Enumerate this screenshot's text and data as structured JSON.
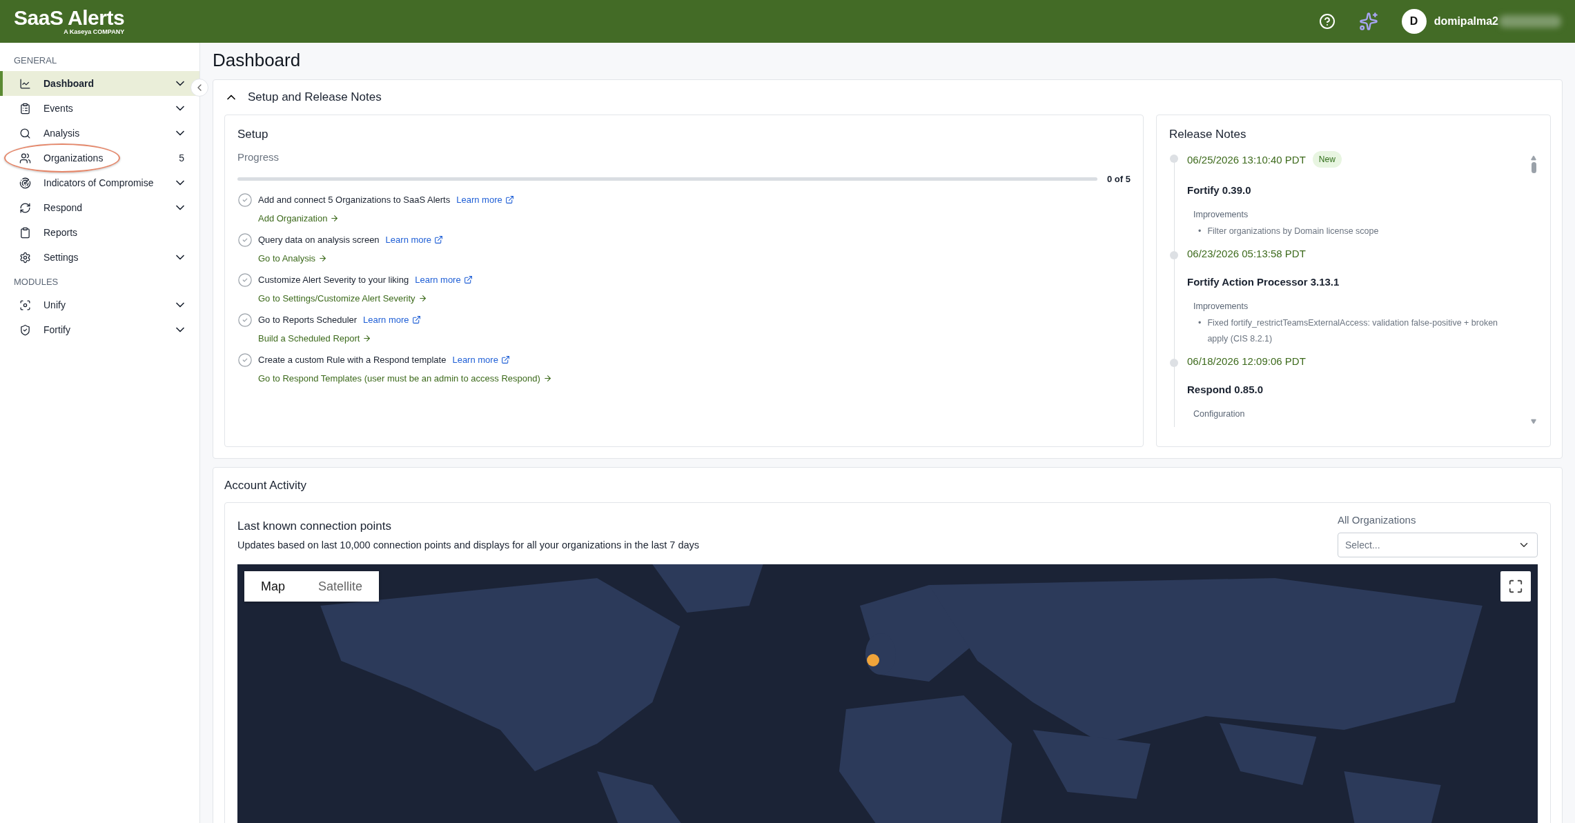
{
  "header": {
    "logo": "SaaS Alerts",
    "logo_sub": "A Kaseya COMPANY",
    "user": {
      "avatar": "D",
      "name": "domipalma2",
      "blurred": true
    }
  },
  "sidebar": {
    "sections": [
      {
        "title": "GENERAL",
        "items": [
          {
            "label": "Dashboard",
            "selected": true,
            "expandable": true
          },
          {
            "label": "Events",
            "selected": false,
            "expandable": true
          },
          {
            "label": "Analysis",
            "selected": false,
            "expandable": true
          },
          {
            "label": "Organizations",
            "selected": false,
            "expandable": false,
            "count": "5",
            "highlighted": true
          },
          {
            "label": "Indicators of Compromise",
            "selected": false,
            "expandable": true
          },
          {
            "label": "Respond",
            "selected": false,
            "expandable": true
          },
          {
            "label": "Reports",
            "selected": false,
            "expandable": false
          },
          {
            "label": "Settings",
            "selected": false,
            "expandable": true
          }
        ]
      },
      {
        "title": "MODULES",
        "items": [
          {
            "label": "Unify",
            "selected": false,
            "expandable": true
          },
          {
            "label": "Fortify",
            "selected": false,
            "expandable": true
          }
        ]
      }
    ]
  },
  "page_title": "Dashboard",
  "setup_section": {
    "title": "Setup and Release Notes",
    "expanded": true,
    "setup": {
      "title": "Setup",
      "progress_label": "Progress",
      "level": 0,
      "reading": "0 of 5",
      "steps": [
        {
          "text": "Add and connect 5 Organizations to SaaS Alerts",
          "link": "Learn more",
          "action": "Add Organization",
          "done": false
        },
        {
          "text": "Query data on analysis screen",
          "link": "Learn more",
          "action": "Go to Analysis",
          "done": false
        },
        {
          "text": "Customize Alert Severity to your liking",
          "link": "Learn more",
          "action": "Go to Settings/Customize Alert Severity",
          "done": false
        },
        {
          "text": "Go to Reports Scheduler",
          "link": "Learn more",
          "action": "Build a Scheduled Report",
          "done": false
        },
        {
          "text": "Create a custom Rule with a Respond template",
          "link": "Learn more",
          "action": "Go to Respond Templates (user must be an admin to access Respond)",
          "done": false
        }
      ]
    },
    "release_notes": {
      "title": "Release Notes",
      "entries": [
        {
          "date": "06/25/2026 13:10:40 PDT",
          "badge": "New",
          "title": "Fortify 0.39.0",
          "sections": [
            {
              "heading": "Improvements",
              "bullets": [
                {
                  "marker": "•",
                  "text": "Filter organizations by Domain license scope"
                }
              ]
            }
          ]
        },
        {
          "date": "06/23/2026 05:13:58 PDT",
          "title": "Fortify Action Processor 3.13.1",
          "sections": [
            {
              "heading": "Improvements",
              "bullets": [
                {
                  "marker": "•",
                  "text": "Fixed fortify_restrictTeamsExternalAccess: validation false-positive + broken apply (CIS 8.2.1)"
                }
              ]
            }
          ]
        },
        {
          "date": "06/18/2026 12:09:06 PDT",
          "title": "Respond 0.85.0",
          "sections": [
            {
              "heading": "Configuration"
            }
          ]
        }
      ]
    }
  },
  "account_activity": {
    "title": "Account Activity",
    "card": {
      "title": "Last known connection points",
      "description": "Updates based on last 10,000 connection points and displays for all your organizations in the last 7 days",
      "filter_label": "All Organizations",
      "select_placeholder": "Select...",
      "map_tabs": [
        {
          "label": "Map",
          "selected": true
        },
        {
          "label": "Satellite",
          "selected": false
        }
      ]
    }
  }
}
